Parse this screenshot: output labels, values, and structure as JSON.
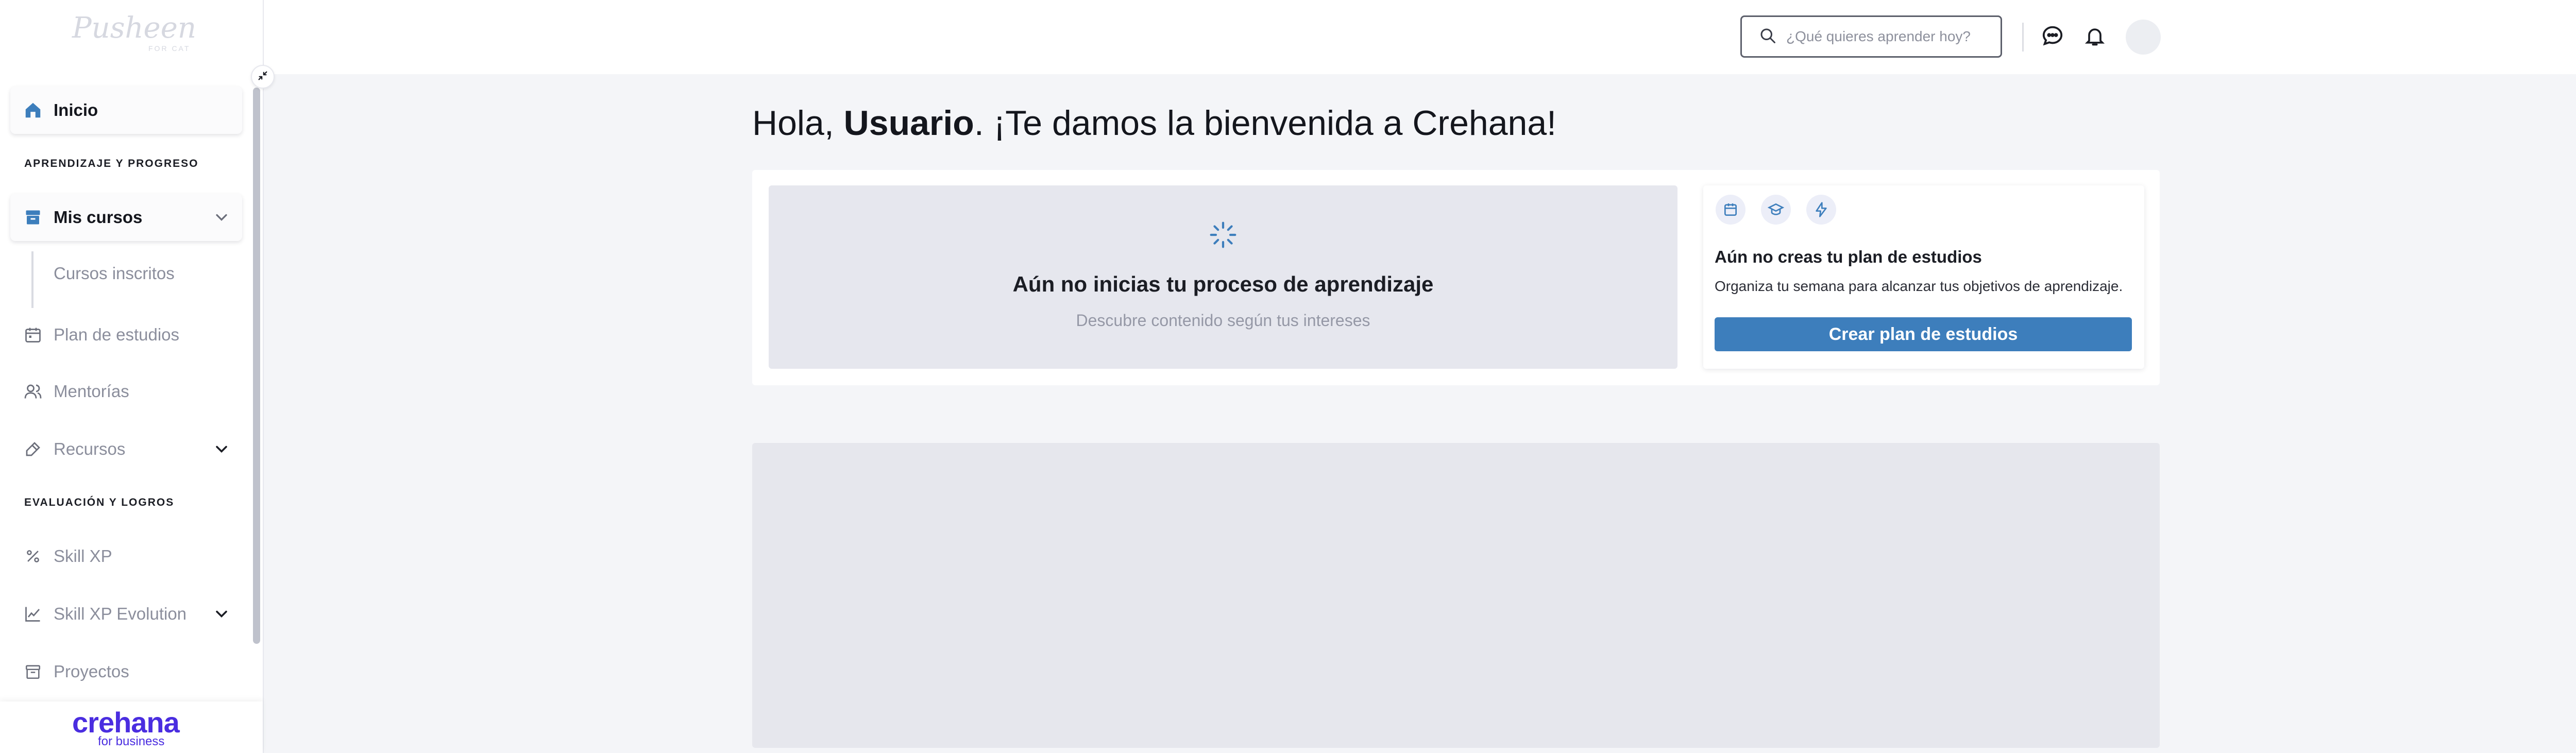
{
  "sidebar": {
    "logo": {
      "text": "Pusheen",
      "sub": "FOR CAT"
    },
    "items": [
      {
        "label": "Inicio",
        "icon": "home-icon"
      },
      {
        "label": "Mis cursos",
        "icon": "archive-icon"
      },
      {
        "label": "Plan de estudios",
        "icon": "calendar-icon"
      },
      {
        "label": "Mentorías",
        "icon": "users-icon"
      },
      {
        "label": "Recursos",
        "icon": "tools-icon"
      },
      {
        "label": "Skill XP",
        "icon": "percent-icon"
      },
      {
        "label": "Skill XP Evolution",
        "icon": "chart-icon"
      },
      {
        "label": "Proyectos",
        "icon": "box-icon"
      }
    ],
    "sections": [
      "APRENDIZAJE Y PROGRESO",
      "EVALUACIÓN Y LOGROS"
    ],
    "subitems": [
      "Cursos inscritos"
    ],
    "footer": {
      "brand": "crehana",
      "brand_sub": "for business",
      "brand_color": "#4a2de0"
    }
  },
  "topbar": {
    "search_placeholder": "¿Qué quieres aprender hoy?",
    "icons": [
      "search-icon",
      "chat-icon",
      "bell-icon",
      "avatar"
    ]
  },
  "main": {
    "greeting_prefix": "Hola, ",
    "greeting_name": "Usuario",
    "greeting_suffix": ". ¡Te damos la bienvenida a Crehana!",
    "empty_state": {
      "title": "Aún no inicias tu proceso de aprendizaje",
      "subtitle": "Descubre contenido según tus intereses"
    },
    "plan_card": {
      "icons": [
        "calendar-icon",
        "graduation-cap-icon",
        "lightning-icon"
      ],
      "title": "Aún no creas tu plan de estudios",
      "description": "Organiza tu semana para alcanzar tus objetivos de aprendizaje.",
      "button": "Crear plan de estudios",
      "button_color": "#3d7ebc"
    }
  }
}
